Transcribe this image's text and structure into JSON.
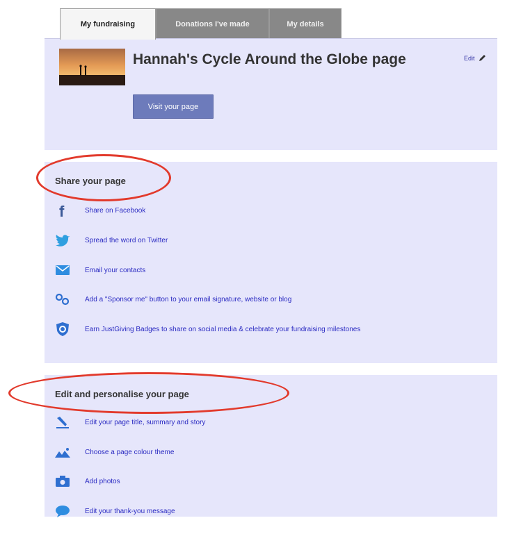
{
  "tabs": [
    {
      "label": "My fundraising",
      "active": true
    },
    {
      "label": "Donations I've made",
      "active": false
    },
    {
      "label": "My details",
      "active": false
    }
  ],
  "header": {
    "page_title": "Hannah's Cycle Around the Globe page",
    "edit_label": "Edit",
    "visit_button": "Visit your page"
  },
  "share": {
    "title": "Share your page",
    "items": [
      {
        "label": "Share on Facebook",
        "icon": "facebook-icon"
      },
      {
        "label": "Spread the word on Twitter",
        "icon": "twitter-icon"
      },
      {
        "label": "Email your contacts",
        "icon": "email-icon"
      },
      {
        "label": "Add a \"Sponsor me\" button to your email signature, website or blog",
        "icon": "sponsor-button-icon"
      },
      {
        "label": "Earn JustGiving Badges to share on social media & celebrate your fundraising milestones",
        "icon": "badge-icon"
      }
    ]
  },
  "personalise": {
    "title": "Edit and personalise your page",
    "items": [
      {
        "label": "Edit your page title, summary and story",
        "icon": "pencil-icon"
      },
      {
        "label": "Choose a page colour theme",
        "icon": "image-theme-icon"
      },
      {
        "label": "Add photos",
        "icon": "camera-icon"
      },
      {
        "label": "Edit your thank-you message",
        "icon": "speech-bubble-icon"
      }
    ]
  },
  "colors": {
    "panel_bg": "#e6e6fb",
    "link": "#2b2bc2",
    "tab_inactive": "#888888",
    "highlight_oval": "#e23a2c",
    "button": "#6d7bbb"
  }
}
